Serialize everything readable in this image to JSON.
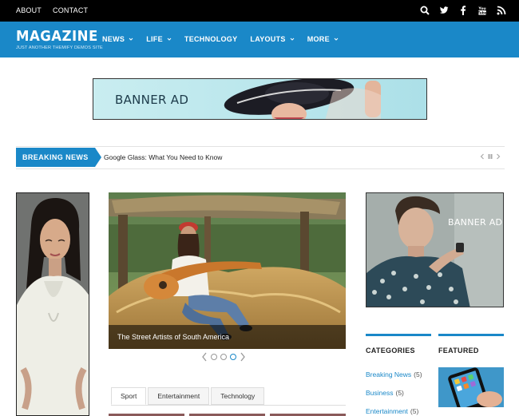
{
  "topbar": {
    "links": [
      "ABOUT",
      "CONTACT"
    ],
    "social_icons": [
      "search-icon",
      "twitter-icon",
      "facebook-icon",
      "youtube-icon",
      "rss-icon"
    ]
  },
  "header": {
    "logo_title": "MAGAZINE",
    "logo_subtitle": "JUST ANOTHER THEMIFY DEMOS SITE",
    "nav": [
      {
        "label": "NEWS",
        "has_dropdown": true
      },
      {
        "label": "LIFE",
        "has_dropdown": true
      },
      {
        "label": "TECHNOLOGY",
        "has_dropdown": false
      },
      {
        "label": "LAYOUTS",
        "has_dropdown": true
      },
      {
        "label": "MORE",
        "has_dropdown": true
      }
    ]
  },
  "top_banner": {
    "text": "BANNER AD"
  },
  "breaking_news": {
    "label": "BREAKING NEWS",
    "headline": "Google Glass: What You Need to Know"
  },
  "slider": {
    "caption": "The Street Artists of South America",
    "slide_count": 3,
    "active_slide": 3
  },
  "tabs": {
    "items": [
      "Sport",
      "Entertainment",
      "Technology"
    ],
    "active": "Sport"
  },
  "right_banner": {
    "text": "BANNER AD"
  },
  "categories": {
    "title": "CATEGORIES",
    "items": [
      {
        "label": "Breaking News",
        "count": "(5)"
      },
      {
        "label": "Business",
        "count": "(5)"
      },
      {
        "label": "Entertainment",
        "count": "(5)"
      }
    ]
  },
  "featured": {
    "title": "FEATURED"
  },
  "colors": {
    "accent": "#1a88c8",
    "topbar": "#000000"
  }
}
